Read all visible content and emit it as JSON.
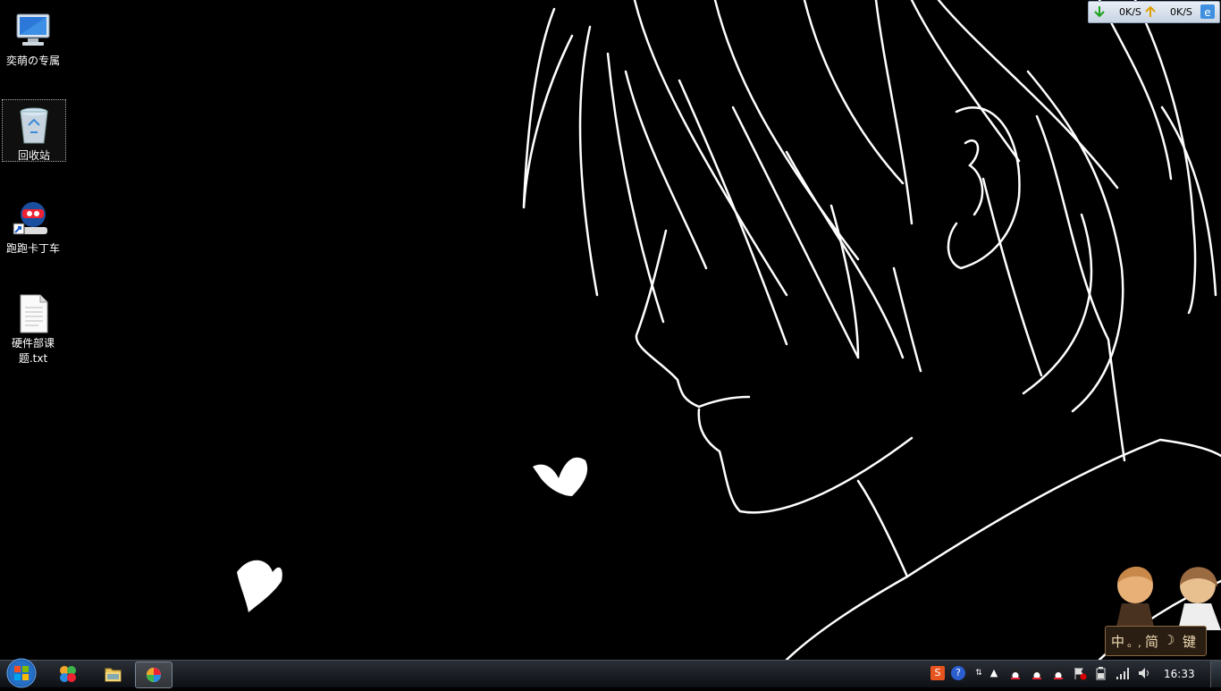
{
  "desktop": {
    "icons": [
      {
        "label": "奕萌の专属"
      },
      {
        "label": "回收站"
      },
      {
        "label": "跑跑卡丁车"
      },
      {
        "label": "硬件部课题.txt"
      }
    ]
  },
  "net_meter": {
    "download": "0K/S",
    "upload": "0K/S"
  },
  "ime_toolbar": {
    "mode": "中",
    "punct": "。,",
    "charset": "简",
    "width": "☽",
    "softkey": "键"
  },
  "taskbar": {
    "clock": "16:33",
    "tray_help": "?"
  },
  "colors": {
    "taskbar": "#1a1e24",
    "accent": "#3f8fe0"
  }
}
